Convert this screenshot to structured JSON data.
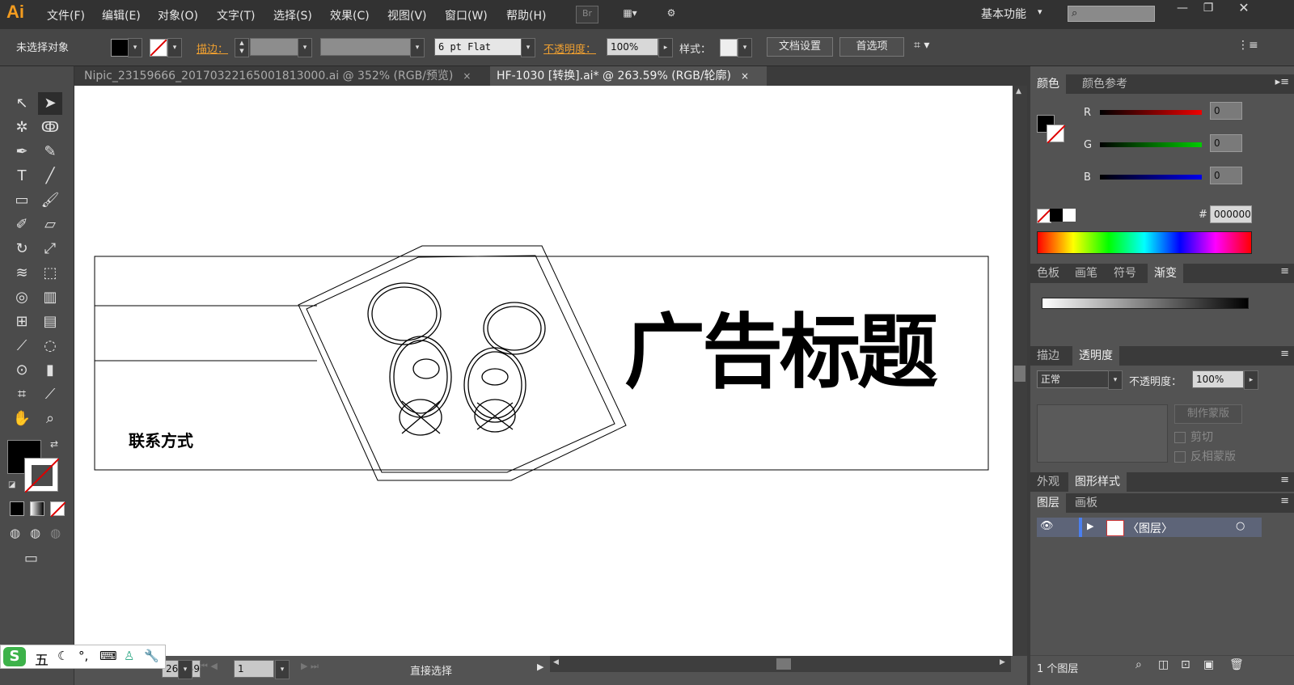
{
  "app": {
    "logo": "Ai"
  },
  "menu": [
    "文件(F)",
    "编辑(E)",
    "对象(O)",
    "文字(T)",
    "选择(S)",
    "效果(C)",
    "视图(V)",
    "窗口(W)",
    "帮助(H)"
  ],
  "topbar": {
    "br": "Br",
    "workspace": "基本功能",
    "workspace_caret": "▾"
  },
  "control": {
    "no_selection": "未选择对象",
    "stroke_label": "描边：",
    "stroke_profile": "6 pt Flat",
    "opacity_label": "不透明度：",
    "opacity_value": "100%",
    "style_label": "样式：",
    "doc_setup": "文档设置",
    "preferences": "首选项"
  },
  "tabs": [
    {
      "label": "Nipic_23159666_20170322165001813000.ai @ 352% (RGB/预览)",
      "close": "×",
      "active": false
    },
    {
      "label": "HF-1030 [转换].ai* @ 263.59% (RGB/轮廓)",
      "close": "×",
      "active": true
    }
  ],
  "artwork": {
    "ad_title": "广告标题",
    "contact": "联系方式"
  },
  "status": {
    "zoom": "263.59",
    "page": "1",
    "tool_name": "直接选择"
  },
  "ime": {
    "label": "五"
  },
  "color_panel": {
    "tabs": [
      "颜色",
      "颜色参考"
    ],
    "r_label": "R",
    "g_label": "G",
    "b_label": "B",
    "r": "0",
    "g": "0",
    "b": "0",
    "hex_label": "#",
    "hex": "000000"
  },
  "swatch_panel": {
    "tabs": [
      "色板",
      "画笔",
      "符号",
      "渐变"
    ]
  },
  "transparency_panel": {
    "tabs": [
      "描边",
      "透明度"
    ],
    "blend_mode": "正常",
    "opacity_label": "不透明度：",
    "opacity_value": "100%",
    "make_mask": "制作蒙版",
    "clip": "剪切",
    "invert_mask": "反相蒙版"
  },
  "appearance_panel": {
    "tabs": [
      "外观",
      "图形样式"
    ]
  },
  "layers_panel": {
    "tabs": [
      "图层",
      "画板"
    ],
    "layer_name": "〈图层〉",
    "count": "1 个图层"
  },
  "colors": {
    "accent": "#f39c1f",
    "ui_dark": "#323232",
    "panel": "#535353",
    "canvas": "#ffffff"
  }
}
